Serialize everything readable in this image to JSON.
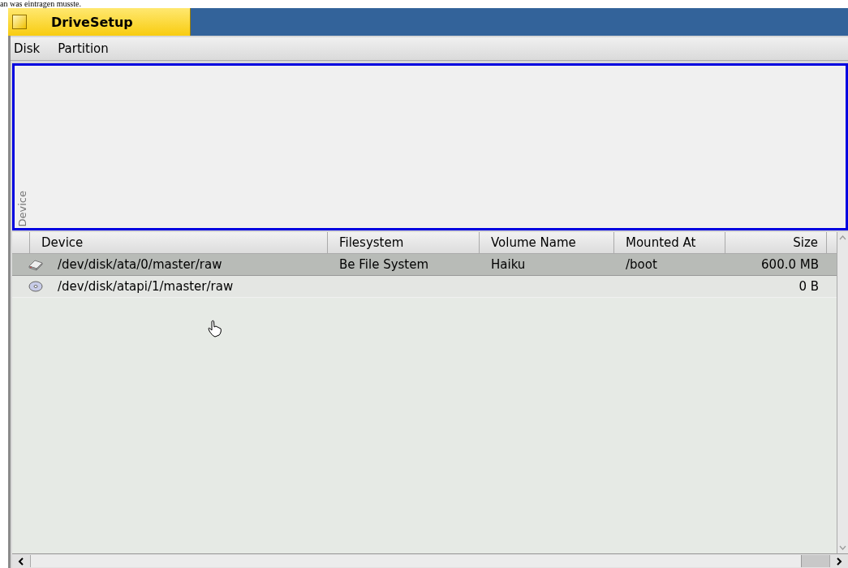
{
  "caption": "an was eintragen musste.",
  "window": {
    "title": "DriveSetup"
  },
  "menu": [
    {
      "label": "Disk"
    },
    {
      "label": "Partition"
    }
  ],
  "disk_map": {
    "label": "Device"
  },
  "table": {
    "columns": [
      {
        "label": "Device"
      },
      {
        "label": "Filesystem"
      },
      {
        "label": "Volume Name"
      },
      {
        "label": "Mounted At"
      },
      {
        "label": "Size"
      }
    ],
    "rows": [
      {
        "kind": "harddisk",
        "selected": true,
        "cells": [
          "/dev/disk/ata/0/master/raw",
          "Be File System",
          "Haiku",
          "/boot",
          "600.0 MB"
        ]
      },
      {
        "kind": "cd",
        "selected": false,
        "cells": [
          "/dev/disk/atapi/1/master/raw",
          "",
          "",
          "",
          "0 B"
        ]
      }
    ]
  }
}
